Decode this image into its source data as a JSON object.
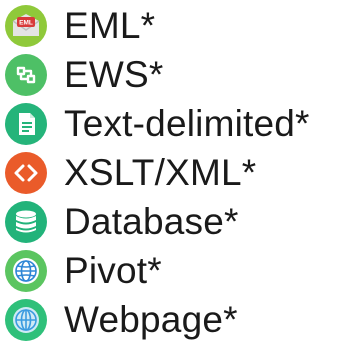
{
  "items": [
    {
      "label": "EML*",
      "icon": "eml-envelope-icon",
      "icon_text": "EML",
      "color": "#8fc93a",
      "inner_color": "#e4e4e4",
      "accent": "#d83a3a"
    },
    {
      "label": "EWS*",
      "icon": "ews-exchange-icon",
      "color": "#4ec066",
      "inner_color": "#ffffff"
    },
    {
      "label": "Text-delimited*",
      "icon": "text-document-icon",
      "color": "#25b47a",
      "inner_color": "#ffffff"
    },
    {
      "label": "XSLT/XML*",
      "icon": "xml-code-icon",
      "color": "#ea5b2a",
      "inner_color": "#ffffff"
    },
    {
      "label": "Database*",
      "icon": "database-icon",
      "color": "#22b37a",
      "inner_color": "#ffffff"
    },
    {
      "label": "Pivot*",
      "icon": "globe-icon",
      "color": "#5bc560",
      "inner_color": "#ffffff",
      "globe_color": "#2e86d6"
    },
    {
      "label": "Webpage*",
      "icon": "web-globe-icon",
      "color": "#2fc07a",
      "inner_color": "#cfeaf5",
      "globe_color": "#3a9be0"
    }
  ]
}
